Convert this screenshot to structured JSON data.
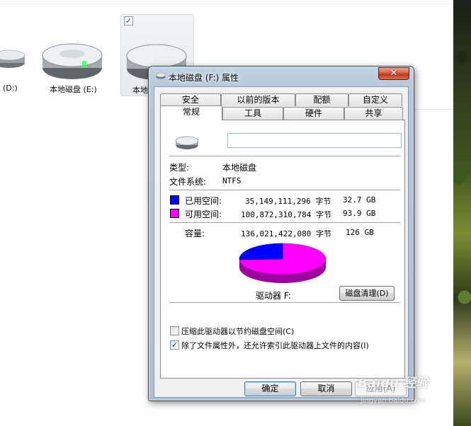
{
  "explorer": {
    "drives": [
      {
        "label": "(D:)"
      },
      {
        "label": "本地磁盘 (E:)"
      },
      {
        "label": "本地",
        "checked": true
      }
    ]
  },
  "dialog": {
    "title": "本地磁盘 (F:) 属性",
    "close_glyph": "✕",
    "tabs_row1": [
      "安全",
      "以前的版本",
      "配额",
      "自定义"
    ],
    "tabs_row2": [
      "常规",
      "工具",
      "硬件",
      "共享"
    ],
    "active_tab": "常规",
    "name_field": {
      "value": ""
    },
    "type": {
      "label": "类型:",
      "value": "本地磁盘"
    },
    "filesystem": {
      "label": "文件系统:",
      "value": "NTFS"
    },
    "used": {
      "label": "已用空间:",
      "bytes": "35,149,111,296 字节",
      "size": "32.7 GB",
      "color": "#0000ff"
    },
    "free": {
      "label": "可用空间:",
      "bytes": "100,872,310,784 字节",
      "size": "93.9 GB",
      "color": "#ff00ff"
    },
    "capacity": {
      "label": "容量:",
      "bytes": "136,021,422,080 字节",
      "size": "126 GB"
    },
    "used_fraction": 0.258,
    "drive_label": "驱动器 F:",
    "cleanup_button": "磁盘清理(D)",
    "compress_checkbox": {
      "label": "压缩此驱动器以节约磁盘空间(C)",
      "checked": false
    },
    "index_checkbox": {
      "label": "除了文件属性外，还允许索引此驱动器上文件的内容(I)",
      "checked": true
    },
    "buttons": {
      "ok": "确定",
      "cancel": "取消",
      "apply": "应用(A)"
    }
  },
  "watermark": {
    "brand": "Baidu 经验",
    "url": "jingyan.baidu.com"
  }
}
